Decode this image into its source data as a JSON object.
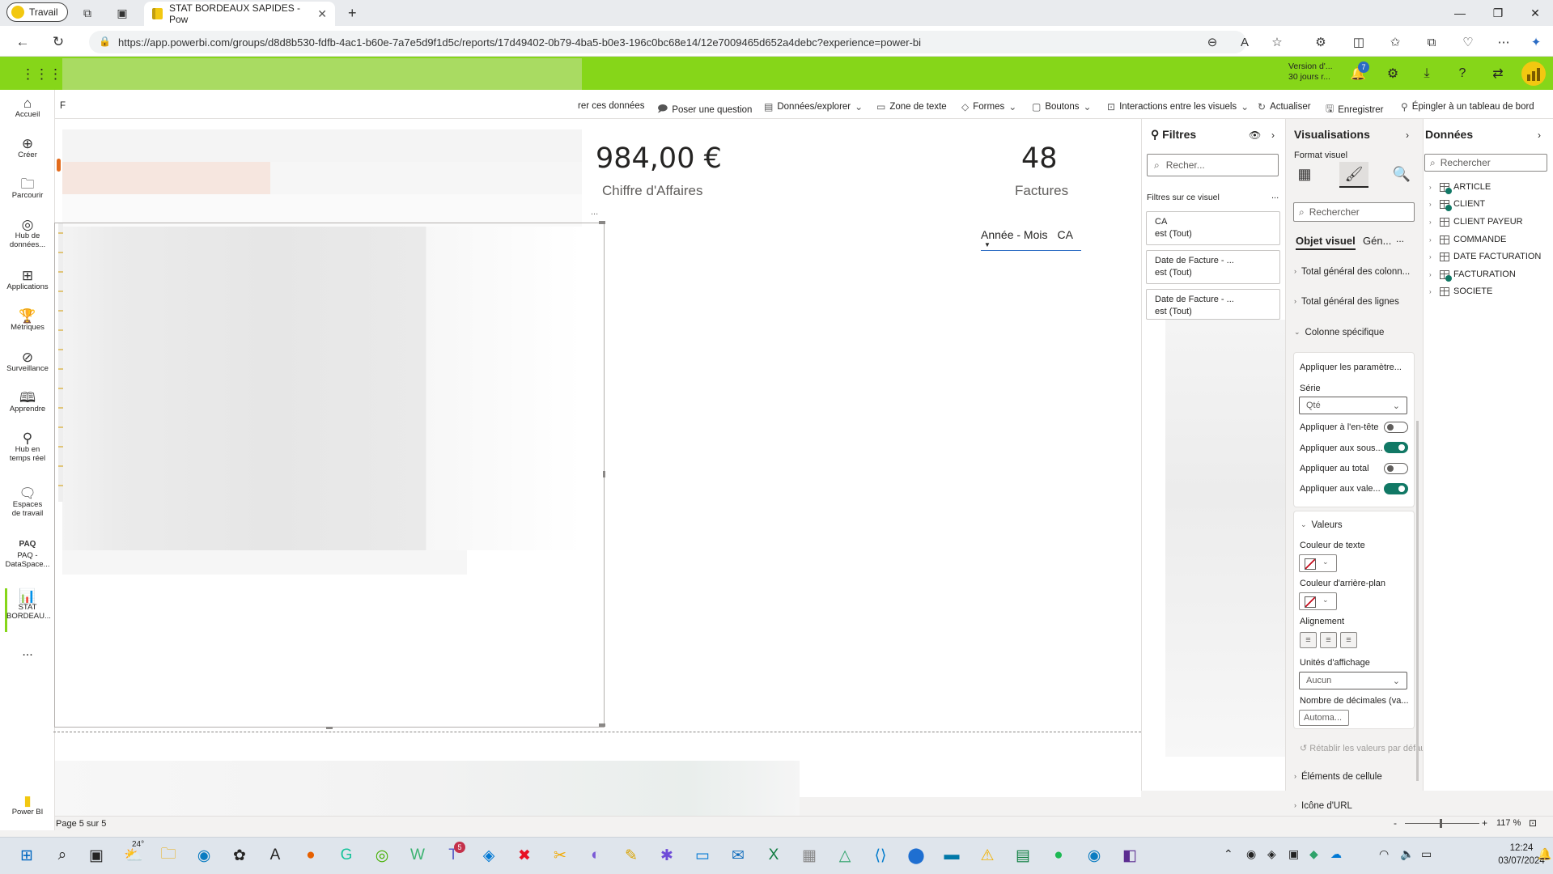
{
  "browser": {
    "profile_label": "Travail",
    "tab_title": "STAT BORDEAUX SAPIDES - Power BI",
    "tab_title_visible": "STAT BORDEAUX SAPIDES - Pow",
    "url": "https://app.powerbi.com/groups/d8d8b530-fdfb-4ac1-b60e-7a7e5d9f1d5c/reports/17d49402-0b79-4ba5-b0e3-196c0bc68e14/12e7009465d652a4debc?experience=power-bi"
  },
  "header": {
    "trial_line1": "Version d'...",
    "trial_line2": "30 jours r...",
    "notifications_count": "7"
  },
  "leftnav": {
    "items": [
      {
        "label": "Accueil",
        "icon": "home-icon"
      },
      {
        "label": "Créer",
        "icon": "plus-circle-icon"
      },
      {
        "label": "Parcourir",
        "icon": "folder-icon"
      },
      {
        "label": "Hub de données...",
        "icon": "data-hub-icon"
      },
      {
        "label": "Applications",
        "icon": "apps-icon"
      },
      {
        "label": "Métriques",
        "icon": "trophy-icon"
      },
      {
        "label": "Surveillance",
        "icon": "monitor-icon"
      },
      {
        "label": "Apprendre",
        "icon": "book-icon"
      },
      {
        "label": "Hub en temps réel",
        "icon": "realtime-hub-icon"
      },
      {
        "label": "Espaces de travail",
        "icon": "workspaces-icon"
      },
      {
        "label": "PAQ - DataSpace...",
        "icon": "workspace-icon"
      },
      {
        "label": "STAT BORDEAU...",
        "icon": "report-icon"
      }
    ],
    "more_label": "...",
    "footer_label": "Power BI"
  },
  "ribbon": {
    "items": [
      "F",
      "rer ces données",
      "Poser une question",
      "Données/explorer",
      "Zone de texte",
      "Formes",
      "Boutons",
      "Interactions entre les visuels",
      "Actualiser",
      "Enregistrer",
      "Épingler à un tableau de bord"
    ]
  },
  "canvas": {
    "card1_value": "984,00 €",
    "card1_label": "Chiffre d'Affaires",
    "card2_value": "48",
    "card2_label": "Factures",
    "slicer_field1": "Année - Mois",
    "slicer_field2": "CA",
    "more_options": "...",
    "page_label": "Page 5 sur 5",
    "zoom": "117 %"
  },
  "filters": {
    "title": "Filtres",
    "search_placeholder": "Recher...",
    "section_label": "Filtres sur ce visuel",
    "more": "...",
    "cards": [
      {
        "name": "CA",
        "state": "est (Tout)"
      },
      {
        "name": "Date de Facture - ...",
        "state": "est (Tout)"
      },
      {
        "name": "Date de Facture - ...",
        "state": "est (Tout)"
      }
    ]
  },
  "visualizations": {
    "title": "Visualisations",
    "format_label": "Format visuel",
    "search_placeholder": "Rechercher",
    "tab_visual": "Objet visuel",
    "tab_general": "Gén...",
    "tab_more": "...",
    "section_col_totals": "Total général des colonn...",
    "section_row_totals": "Total général des lignes",
    "section_specific": "Colonne spécifique",
    "apply_settings": "Appliquer les paramètre...",
    "serie_label": "Série",
    "serie_value": "Qté",
    "toggles": [
      {
        "label": "Appliquer à l'en-tête",
        "on": false
      },
      {
        "label": "Appliquer aux sous...",
        "on": true
      },
      {
        "label": "Appliquer au total",
        "on": false
      },
      {
        "label": "Appliquer aux vale...",
        "on": true
      }
    ],
    "values_section": "Valeurs",
    "text_color_label": "Couleur de texte",
    "bg_color_label": "Couleur d'arrière-plan",
    "alignment_label": "Alignement",
    "display_units_label": "Unités d'affichage",
    "display_units_value": "Aucun",
    "decimals_label": "Nombre de décimales (va...",
    "decimals_value": "Automa...",
    "reset_label": "Rétablir les valeurs par défaut",
    "cell_elements": "Éléments de cellule",
    "url_icon": "Icône d'URL"
  },
  "data": {
    "title": "Données",
    "search_placeholder": "Rechercher",
    "tables": [
      {
        "name": "ARTICLE",
        "checked": true
      },
      {
        "name": "CLIENT",
        "checked": true
      },
      {
        "name": "CLIENT PAYEUR",
        "checked": false
      },
      {
        "name": "COMMANDE",
        "checked": false
      },
      {
        "name": "DATE FACTURATION",
        "checked": false
      },
      {
        "name": "FACTURATION",
        "checked": true
      },
      {
        "name": "SOCIETE",
        "checked": false
      }
    ]
  },
  "taskbar": {
    "weather": "24°",
    "teams_badge": "5",
    "time": "12:24",
    "date": "03/07/2024"
  },
  "colors": {
    "header_green": "#86d619",
    "accent_blue": "#2b6cc4",
    "toggle_on": "#117865"
  }
}
